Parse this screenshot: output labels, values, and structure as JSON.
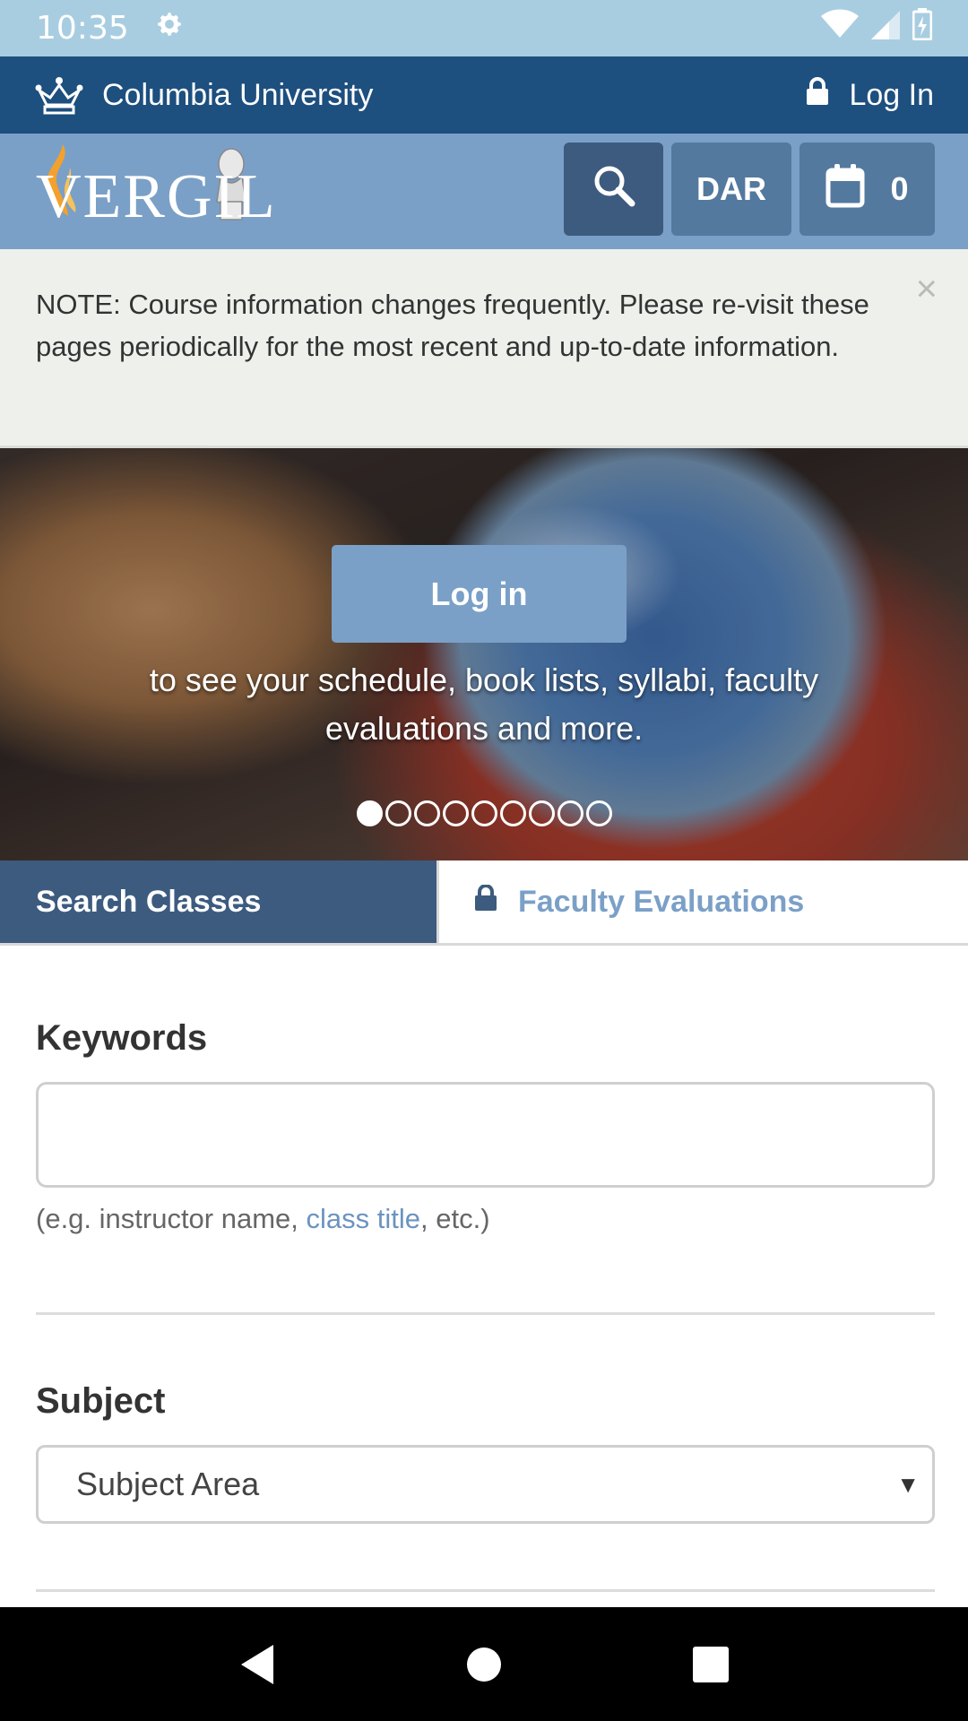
{
  "status_bar": {
    "time": "10:35",
    "icons": [
      "gear-icon",
      "wifi-icon",
      "signal-icon",
      "battery-icon"
    ]
  },
  "columbia_bar": {
    "title": "Columbia University",
    "login_label": "Log In",
    "icons": [
      "crown-icon",
      "lock-icon"
    ]
  },
  "header": {
    "logo_text": "VERGIL",
    "dar_label": "DAR",
    "cart_count": "0",
    "icons": [
      "search-icon",
      "calendar-icon"
    ]
  },
  "note": {
    "text": "NOTE: Course information changes frequently. Please re-visit these pages periodically for the most recent and up-to-date information.",
    "close_label": "×"
  },
  "hero": {
    "login_button": "Log in",
    "tagline": "to see your schedule, book lists, syllabi, faculty evaluations and more.",
    "slide_count": 9,
    "active_slide": 1
  },
  "tabs": {
    "search_classes": "Search Classes",
    "faculty_evaluations": "Faculty Evaluations"
  },
  "form": {
    "keywords_label": "Keywords",
    "keywords_value": "",
    "hint_prefix": "(e.g. instructor name, ",
    "hint_link": "class title",
    "hint_suffix": ", etc.)",
    "subject_label": "Subject",
    "subject_selected": "Subject Area"
  },
  "colors": {
    "status_bar": "#a9cde0",
    "columbia_bar": "#1d4f7f",
    "header": "#7ba0c7",
    "dark_button": "#3c5b7f",
    "accent": "#7ba0c7"
  }
}
